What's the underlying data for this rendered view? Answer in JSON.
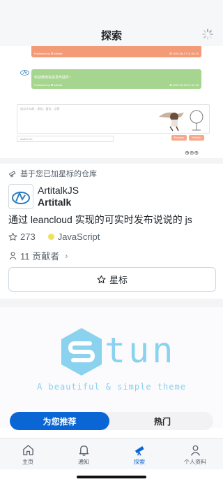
{
  "header": {
    "title": "探索"
  },
  "preview": {
    "bubble_orange_left": "Published by ✪ Artitalk",
    "bubble_orange_right": "✪ 2020-06-27 01:50:19",
    "bubble_green_text": "欢迎使用说说发布插件~",
    "bubble_green_left": "Published by ✪ Artitalk",
    "bubble_green_right": "✪ 2020-06-26 21:34:48",
    "input_hint": "说点什么吧... 发帖、留言、点赞",
    "nick_hint": "Author url",
    "btn_preview": "Preview",
    "btn_publish": "Publish"
  },
  "feed": {
    "reason": "基于您已加星标的仓库",
    "repo_owner": "ArtitalkJS",
    "repo_name": "Artitalk",
    "description": "通过 leancloud 实现的可实时发布说说的 js",
    "stars": "273",
    "language": "JavaScript",
    "language_color": "#f1e05a",
    "contributors": "11 贡献者",
    "star_button": "星标"
  },
  "hero": {
    "word": "tun",
    "subtitle": "A beautiful & simple theme"
  },
  "segmented": {
    "active": "为您推荐",
    "inactive": "热门"
  },
  "tabbar": {
    "items": [
      {
        "label": "主页",
        "icon": "home-icon"
      },
      {
        "label": "通知",
        "icon": "bell-icon"
      },
      {
        "label": "探索",
        "icon": "telescope-icon"
      },
      {
        "label": "个人资料",
        "icon": "person-icon"
      }
    ]
  },
  "colors": {
    "accent": "#0a66d4",
    "hero": "#8ad2ee"
  }
}
